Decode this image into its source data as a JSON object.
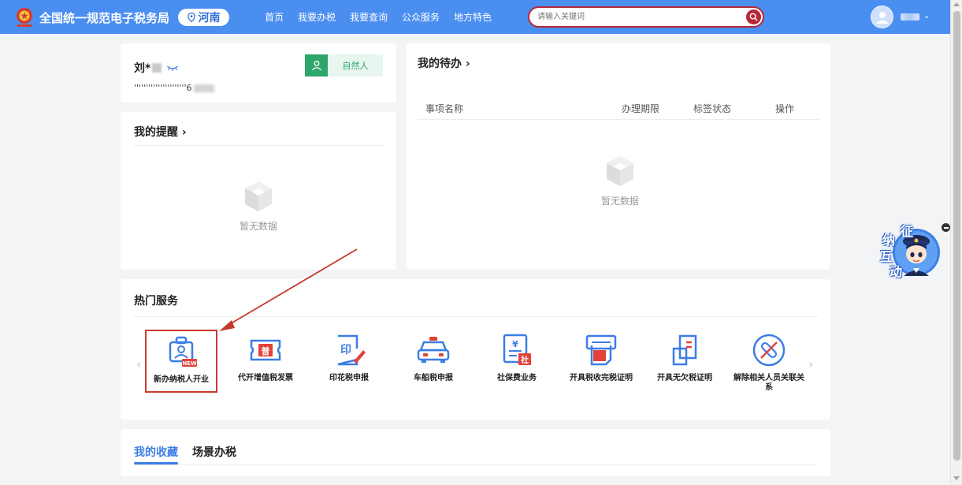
{
  "header": {
    "site_title": "全国统一规范电子税务局",
    "region": "河南",
    "nav": [
      "首页",
      "我要办税",
      "我要查询",
      "公众服务",
      "地方特色"
    ],
    "search_placeholder": "请输入关键词"
  },
  "profile": {
    "name": "刘*",
    "tax_id": "''''''''''''''''''''''6",
    "identity": "自然人"
  },
  "reminders": {
    "title": "我的提醒",
    "empty_text": "暂无数据"
  },
  "todo": {
    "title": "我的待办",
    "columns": [
      "事项名称",
      "办理期限",
      "标签状态",
      "操作"
    ],
    "empty_text": "暂无数据"
  },
  "hot_services": {
    "title": "热门服务",
    "items": [
      {
        "label": "新办纳税人开业",
        "icon": "new-taxpayer-icon",
        "badge": "NEW"
      },
      {
        "label": "代开增值税发票",
        "icon": "invoice-ticket-icon",
        "badge": "普"
      },
      {
        "label": "印花税申报",
        "icon": "stamp-duty-icon",
        "badge": "印"
      },
      {
        "label": "车船税申报",
        "icon": "vehicle-tax-icon"
      },
      {
        "label": "社保费业务",
        "icon": "social-security-icon",
        "badge": "¥ 社"
      },
      {
        "label": "开具税收完税证明",
        "icon": "tax-payment-certificate-icon"
      },
      {
        "label": "开具无欠税证明",
        "icon": "no-arrears-certificate-icon"
      },
      {
        "label": "解除相关人员关联关系",
        "icon": "unlink-relation-icon"
      }
    ]
  },
  "favorites": {
    "tabs": [
      "我的收藏",
      "场景办税"
    ]
  },
  "widget": {
    "chars": [
      "征",
      "纳",
      "互",
      "动"
    ]
  },
  "colors": {
    "header_blue": "#4a8ef0",
    "accent_blue": "#3c7de6",
    "identity_green": "#2ea56b",
    "search_red": "#b8283a",
    "annotation_red": "#c73b2c"
  }
}
